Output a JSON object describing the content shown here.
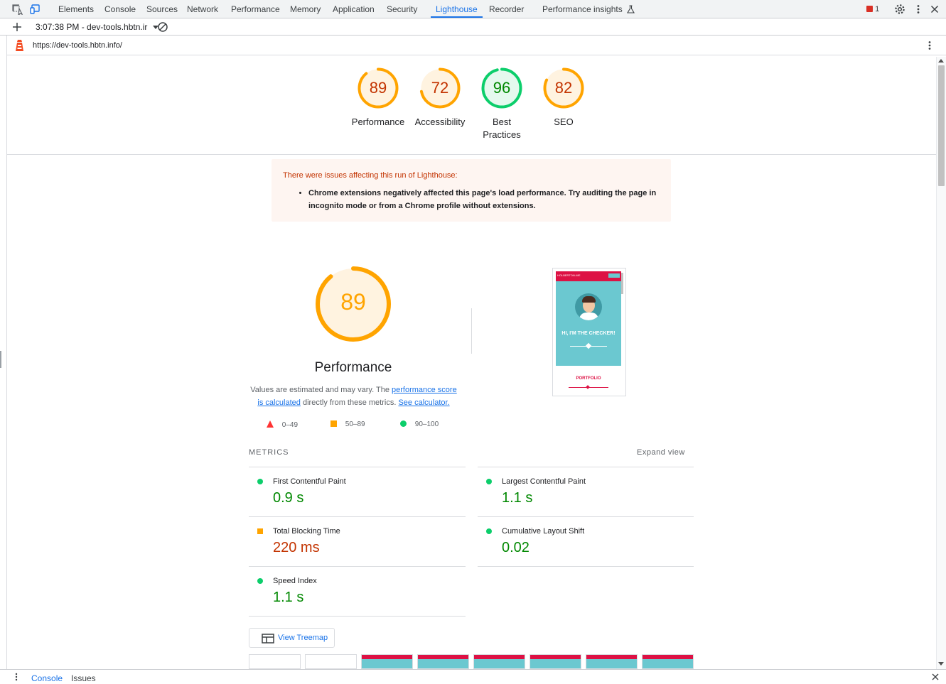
{
  "tabbar": {
    "tabs": [
      "Elements",
      "Console",
      "Sources",
      "Network",
      "Performance",
      "Memory",
      "Application",
      "Security",
      "Lighthouse",
      "Recorder",
      "Performance insights"
    ],
    "active_tab": "Lighthouse",
    "issues_count": "1"
  },
  "toolbar": {
    "report_selector": "3:07:38 PM - dev-tools.hbtn.ir"
  },
  "url_row": {
    "url": "https://dev-tools.hbtn.info/"
  },
  "scores": [
    {
      "value": "89",
      "label": "Performance",
      "fraction": 0.89
    },
    {
      "value": "72",
      "label": "Accessibility",
      "fraction": 0.72
    },
    {
      "value": "96",
      "label": "Best Practices",
      "fraction": 0.96
    },
    {
      "value": "82",
      "label": "SEO",
      "fraction": 0.82
    }
  ],
  "colors": {
    "average": "#ffa400",
    "average_text": "#c33300",
    "pass": "#0cce6b",
    "pass_text": "#008800",
    "fail": "#ff3333",
    "link": "#1a73e8"
  },
  "warning": {
    "title": "There were issues affecting this run of Lighthouse:",
    "item": "Chrome extensions negatively affected this page's load performance. Try auditing the page in incognito mode or from a Chrome profile without extensions."
  },
  "performance": {
    "score": "89",
    "fraction": 0.89,
    "title": "Performance",
    "desc_prefix": "Values are estimated and may vary. The ",
    "desc_link1": "performance score is calculated",
    "desc_mid": " directly from these metrics. ",
    "desc_link2": "See calculator.",
    "legend": [
      "0–49",
      "50–89",
      "90–100"
    ]
  },
  "screenshot": {
    "header": "HOLBERTON-WE",
    "hero": "HI, I'M THE CHECKER!",
    "portfolio": "PORTFOLIO"
  },
  "metrics": {
    "header": "METRICS",
    "expand": "Expand view",
    "items": [
      {
        "name": "First Contentful Paint",
        "value": "0.9 s",
        "rating": "pass"
      },
      {
        "name": "Largest Contentful Paint",
        "value": "1.1 s",
        "rating": "pass"
      },
      {
        "name": "Total Blocking Time",
        "value": "220 ms",
        "rating": "average"
      },
      {
        "name": "Cumulative Layout Shift",
        "value": "0.02",
        "rating": "pass"
      },
      {
        "name": "Speed Index",
        "value": "1.1 s",
        "rating": "pass"
      }
    ]
  },
  "treemap_button": "View Treemap",
  "drawer": {
    "tabs": [
      "Console",
      "Issues"
    ]
  }
}
